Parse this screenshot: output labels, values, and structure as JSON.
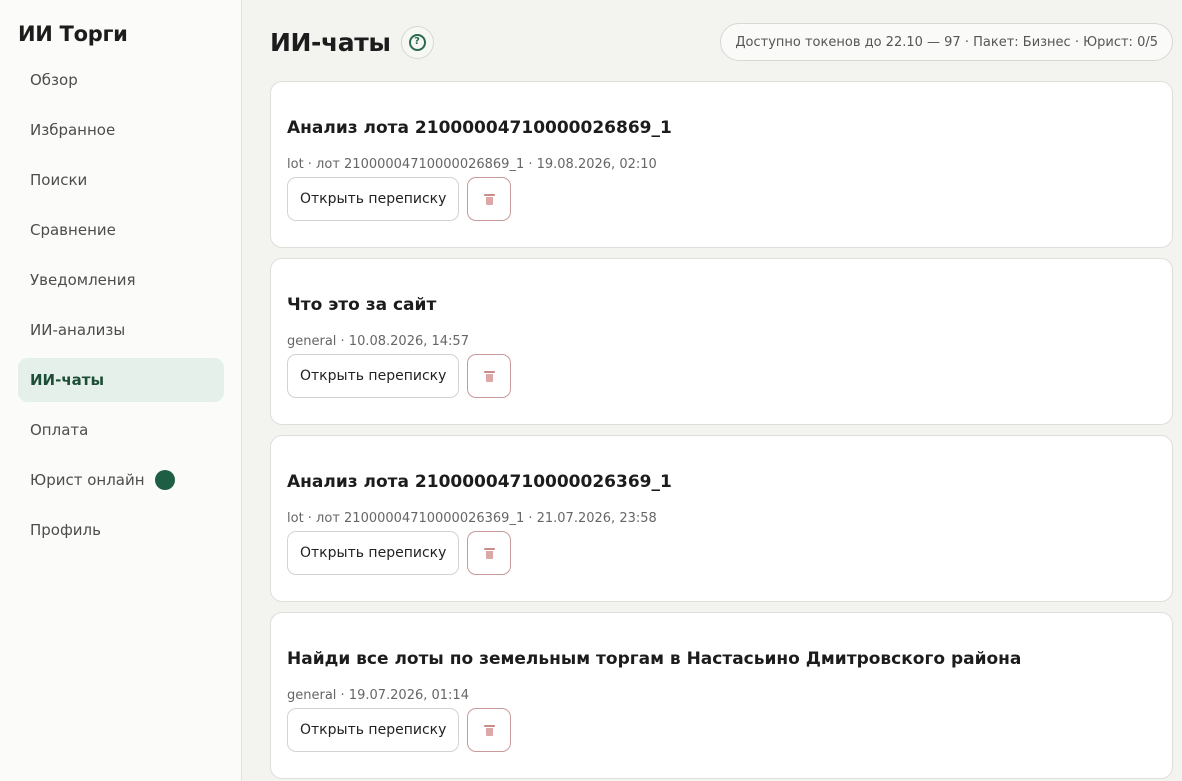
{
  "sidebar": {
    "brand": "ИИ Торги",
    "items": [
      {
        "label": "Обзор"
      },
      {
        "label": "Избранное"
      },
      {
        "label": "Поиски"
      },
      {
        "label": "Сравнение"
      },
      {
        "label": "Уведомления"
      },
      {
        "label": "ИИ-анализы"
      },
      {
        "label": "ИИ-чаты",
        "active": true
      },
      {
        "label": "Оплата"
      },
      {
        "label": "Юрист онлайн",
        "status": "online",
        "status_color": "#1e5e45"
      },
      {
        "label": "Профиль"
      }
    ]
  },
  "header": {
    "title": "ИИ-чаты",
    "help_icon": "question-circle-icon",
    "tokens": "Доступно токенов до 22.10 — 97 · Пакет: Бизнес · Юрист: 0/5"
  },
  "chats": [
    {
      "title": "Анализ лота 21000004710000026869_1",
      "meta": "lot · лот 21000004710000026869_1 · 19.08.2026, 02:10",
      "open_label": "Открыть переписку",
      "delete_icon": "trash-icon"
    },
    {
      "title": "Что это за сайт",
      "meta": "general · 10.08.2026, 14:57",
      "open_label": "Открыть переписку",
      "delete_icon": "trash-icon"
    },
    {
      "title": "Анализ лота 21000004710000026369_1",
      "meta": "lot · лот 21000004710000026369_1 · 21.07.2026, 23:58",
      "open_label": "Открыть переписку",
      "delete_icon": "trash-icon"
    },
    {
      "title": "Найди все лоты по земельным торгам в Настасьино Дмитровского района",
      "meta": "general · 19.07.2026, 01:14",
      "open_label": "Открыть переписку",
      "delete_icon": "trash-icon"
    }
  ],
  "colors": {
    "accent": "#1e5e45",
    "active_bg": "#e4f0e9",
    "delete_border": "#c99a9a"
  }
}
